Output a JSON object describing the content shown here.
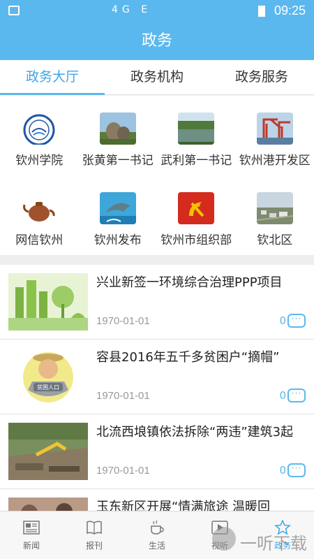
{
  "status_bar": {
    "time": "09:25",
    "indicators": "4G E"
  },
  "title": "政务",
  "tabs": [
    {
      "label": "政务大厅",
      "active": true
    },
    {
      "label": "政务机构",
      "active": false
    },
    {
      "label": "政务服务",
      "active": false
    }
  ],
  "grid": [
    {
      "label": "钦州学院",
      "icon": "university-seal-icon"
    },
    {
      "label": "张黄第一书记",
      "icon": "rock-landscape-icon"
    },
    {
      "label": "武利第一书记",
      "icon": "river-landscape-icon"
    },
    {
      "label": "钦州港开发区",
      "icon": "port-crane-icon"
    },
    {
      "label": "网信钦州",
      "icon": "teapot-icon"
    },
    {
      "label": "钦州发布",
      "icon": "dolphin-icon"
    },
    {
      "label": "钦州市组织部",
      "icon": "party-emblem-icon"
    },
    {
      "label": "钦北区",
      "icon": "city-aerial-icon"
    }
  ],
  "news": [
    {
      "headline": "兴业新签一环境综合治理PPP项目",
      "date": "1970-01-01",
      "comments": "0",
      "image": "green-city-icon"
    },
    {
      "headline": "容县2016年五千多贫困户“摘帽”",
      "date": "1970-01-01",
      "comments": "0",
      "image": "poverty-cartoon-icon",
      "badge_text": "贫困人口"
    },
    {
      "headline": "北流西埌镇依法拆除“两违”建筑3起",
      "date": "1970-01-01",
      "comments": "0",
      "image": "demolition-photo-icon"
    },
    {
      "headline": "玉东新区开展“情满旅途 温暖回",
      "date": "",
      "comments": "",
      "image": "people-photo-icon"
    }
  ],
  "bottom_nav": [
    {
      "label": "新闻",
      "icon": "newspaper-icon",
      "active": false
    },
    {
      "label": "报刊",
      "icon": "book-icon",
      "active": false
    },
    {
      "label": "生活",
      "icon": "coffee-cup-icon",
      "active": false
    },
    {
      "label": "视听",
      "icon": "play-icon",
      "active": false
    },
    {
      "label": "政务",
      "icon": "star-badge-icon",
      "active": true
    }
  ],
  "watermark": "一听下载",
  "colors": {
    "accent": "#5bb8ee",
    "active_text": "#3aa6e6"
  }
}
